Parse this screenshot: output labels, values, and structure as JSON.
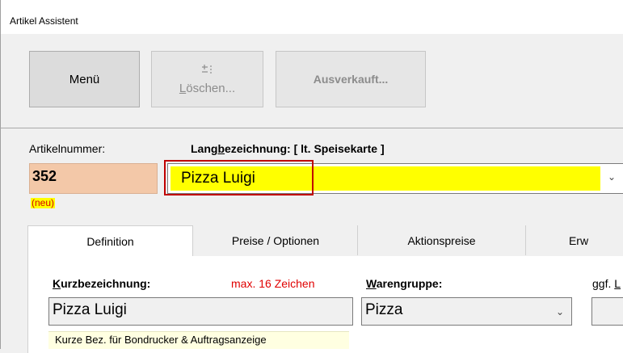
{
  "window": {
    "title": "Artikel Assistent"
  },
  "toolbar": {
    "menu_label": "Menü",
    "loeschen_icon": "eraser-icon",
    "loeschen_first": "L",
    "loeschen_rest": "öschen...",
    "ausverkauft_label": "Ausverkauft..."
  },
  "artikel": {
    "nummer_label": "Artikelnummer:",
    "nummer_value": "352",
    "neu_badge": "(neu)",
    "lang_label_pre": "Lang",
    "lang_label_u": "b",
    "lang_label_post": "ezeichnung:  [ lt. Speisekarte ]",
    "lang_value": "Pizza Luigi"
  },
  "tabs": [
    {
      "label": "Definition",
      "active": true
    },
    {
      "label": "Preise / Optionen"
    },
    {
      "label": "Aktionspreise"
    },
    {
      "label": "Erw"
    }
  ],
  "definition": {
    "kurz_label_u": "K",
    "kurz_label_rest": "urzbezeichnung:",
    "max_hint": "max. 16 Zeichen",
    "waren_label_u": "W",
    "waren_label_rest": "arengruppe:",
    "ggf_label_pre": "ggf. ",
    "ggf_label_u": "L",
    "kurz_value": "Pizza Luigi",
    "waren_value": "Pizza",
    "tooltip": "Kurze Bez. für Bondrucker & Auftragsanzeige"
  },
  "colors": {
    "artnr_bg": "#f3c8a8",
    "highlight_yellow": "#ffff00",
    "error_red": "#d50000",
    "annotation_red": "#c00000"
  }
}
